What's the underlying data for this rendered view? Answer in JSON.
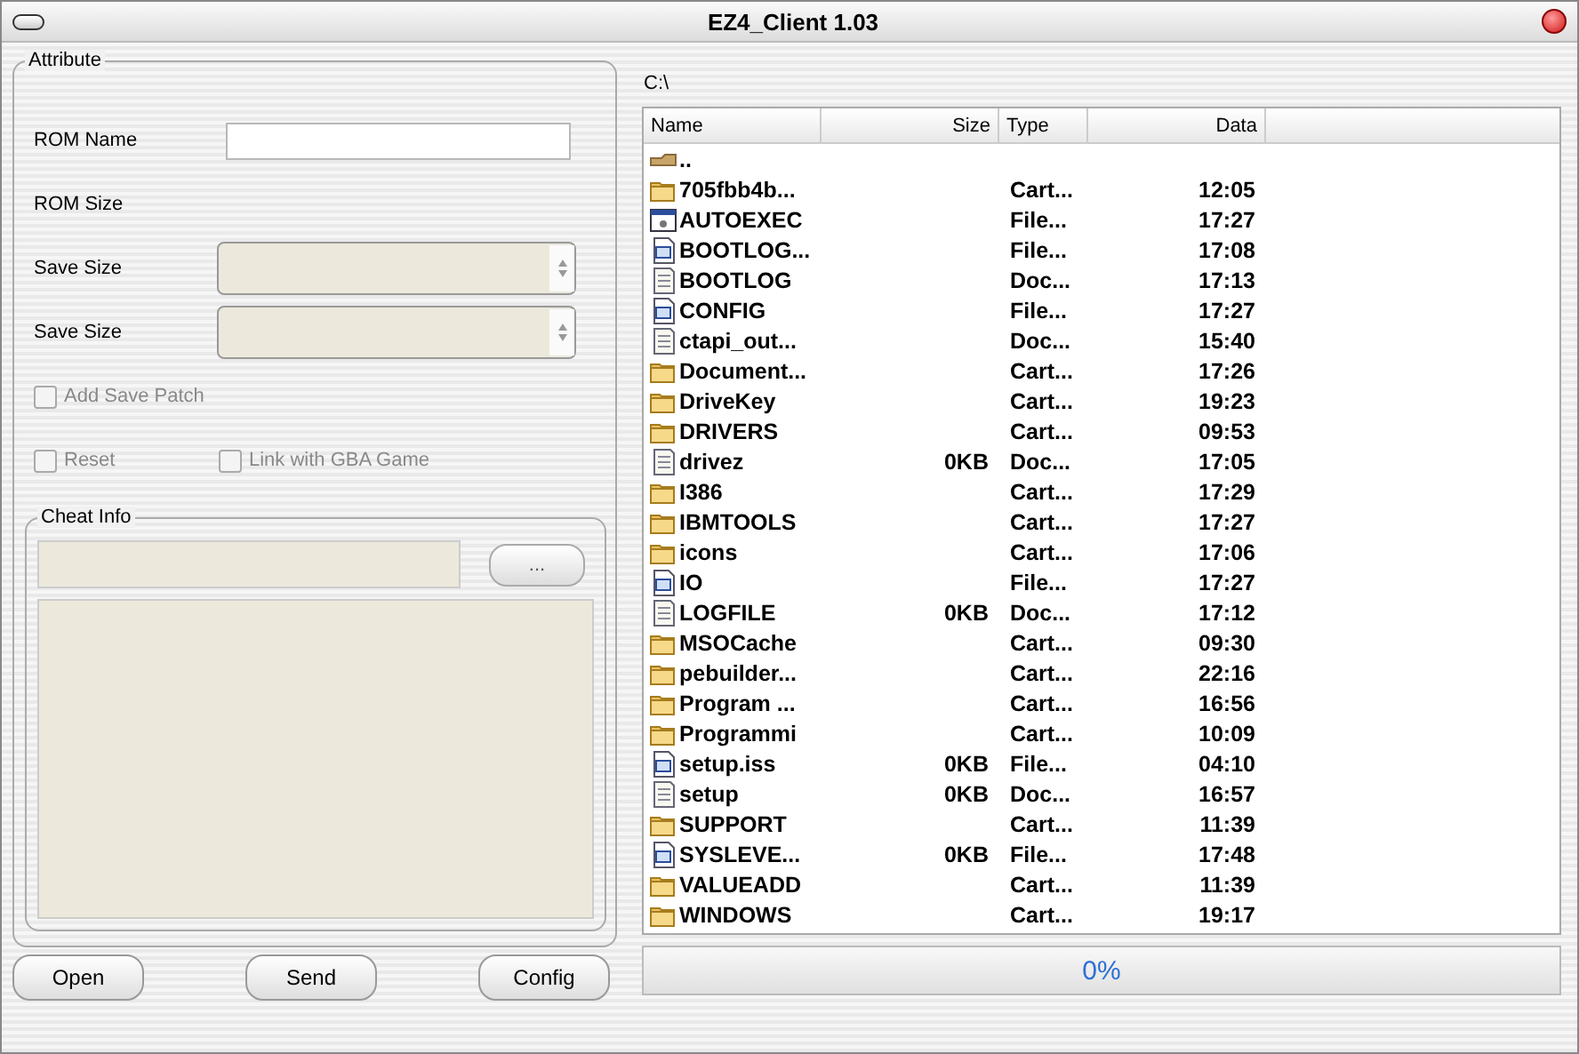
{
  "window": {
    "title": "EZ4_Client 1.03"
  },
  "attribute": {
    "title": "Attribute",
    "rom_name": {
      "label": "ROM Name"
    },
    "rom_size": {
      "label": "ROM Size"
    },
    "selects": [
      {
        "label": "Save Size",
        "disabled": true
      },
      {
        "label": "Save Size",
        "disabled": true
      }
    ],
    "checkboxes": [
      {
        "label": "Add Save Patch",
        "checked": false,
        "disabled": true
      },
      {
        "label": "Reset",
        "checked": false,
        "disabled": true
      },
      {
        "label": "Link with GBA Game",
        "checked": false,
        "disabled": true
      }
    ],
    "cheat_info": {
      "title": "Cheat Info",
      "browse_button": "..."
    }
  },
  "buttons": [
    "Open",
    "Send",
    "Config"
  ],
  "path": "C:\\",
  "file_list": {
    "columns": [
      "Name",
      "Size",
      "Type",
      "Data"
    ],
    "rows": [
      {
        "kind": "up",
        "name": ".."
      },
      {
        "kind": "folder",
        "name": "705fbb4b...",
        "type": "Cart...",
        "data": "12:05"
      },
      {
        "kind": "exe",
        "name": "AUTOEXEC",
        "type": "File...",
        "data": "17:27"
      },
      {
        "kind": "system",
        "name": "BOOTLOG...",
        "type": "File...",
        "data": "17:08"
      },
      {
        "kind": "doc",
        "name": "BOOTLOG",
        "type": "Doc...",
        "data": "17:13"
      },
      {
        "kind": "system",
        "name": "CONFIG",
        "type": "File...",
        "data": "17:27"
      },
      {
        "kind": "doc",
        "name": "ctapi_out...",
        "type": "Doc...",
        "data": "15:40"
      },
      {
        "kind": "folder",
        "name": "Document...",
        "type": "Cart...",
        "data": "17:26"
      },
      {
        "kind": "folder",
        "name": "DriveKey",
        "type": "Cart...",
        "data": "19:23"
      },
      {
        "kind": "folder",
        "name": "DRIVERS",
        "type": "Cart...",
        "data": "09:53"
      },
      {
        "kind": "doc",
        "name": "drivez",
        "size": "0KB",
        "type": "Doc...",
        "data": "17:05"
      },
      {
        "kind": "folder",
        "name": "I386",
        "type": "Cart...",
        "data": "17:29"
      },
      {
        "kind": "folder",
        "name": "IBMTOOLS",
        "type": "Cart...",
        "data": "17:27"
      },
      {
        "kind": "folder",
        "name": "icons",
        "type": "Cart...",
        "data": "17:06"
      },
      {
        "kind": "system",
        "name": "IO",
        "type": "File...",
        "data": "17:27"
      },
      {
        "kind": "doc",
        "name": "LOGFILE",
        "size": "0KB",
        "type": "Doc...",
        "data": "17:12"
      },
      {
        "kind": "folder",
        "name": "MSOCache",
        "type": "Cart...",
        "data": "09:30"
      },
      {
        "kind": "folder",
        "name": "pebuilder...",
        "type": "Cart...",
        "data": "22:16"
      },
      {
        "kind": "folder",
        "name": "Program ...",
        "type": "Cart...",
        "data": "16:56"
      },
      {
        "kind": "folder",
        "name": "Programmi",
        "type": "Cart...",
        "data": "10:09"
      },
      {
        "kind": "system",
        "name": "setup.iss",
        "size": "0KB",
        "type": "File...",
        "data": "04:10"
      },
      {
        "kind": "doc",
        "name": "setup",
        "size": "0KB",
        "type": "Doc...",
        "data": "16:57"
      },
      {
        "kind": "folder",
        "name": "SUPPORT",
        "type": "Cart...",
        "data": "11:39"
      },
      {
        "kind": "system",
        "name": "SYSLEVE...",
        "size": "0KB",
        "type": "File...",
        "data": "17:48"
      },
      {
        "kind": "folder",
        "name": "VALUEADD",
        "type": "Cart...",
        "data": "11:39"
      },
      {
        "kind": "folder",
        "name": "WINDOWS",
        "type": "Cart...",
        "data": "19:17"
      }
    ]
  },
  "progress": {
    "level": 0,
    "reading": "0%"
  }
}
